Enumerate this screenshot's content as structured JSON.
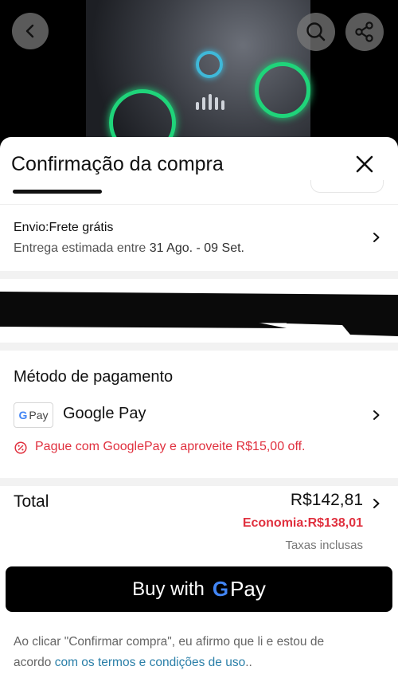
{
  "header": {
    "back_icon": "chevron-left-icon",
    "search_icon": "search-icon",
    "share_icon": "share-icon"
  },
  "sheet": {
    "title": "Confirmação da compra",
    "close_icon": "close-icon"
  },
  "shipping": {
    "title": "Envio:Frete grátis",
    "estimate_prefix": "Entrega estimada entre",
    "estimate_dates": "31 Ago. - 09 Set."
  },
  "payment": {
    "title": "Método de pagamento",
    "badge_g": "G",
    "badge_pay": "Pay",
    "method_name": "Google Pay",
    "promo": "Pague com GooglePay e aproveite R$15,00 off."
  },
  "totals": {
    "label": "Total",
    "value": "R$142,81",
    "economy": "Economia:R$138,01",
    "taxes": "Taxas inclusas"
  },
  "buy_button": {
    "label": "Buy with",
    "g": "G",
    "pay": "Pay"
  },
  "legal": {
    "text": "Ao clicar \"Confirmar compra\", eu afirmo que li e estou de acordo ",
    "link": "com os termos e condições de uso",
    "suffix": ".."
  },
  "colors": {
    "accent_red": "#e0313f",
    "link_blue": "#2a7fa8",
    "button_black": "#000000"
  }
}
